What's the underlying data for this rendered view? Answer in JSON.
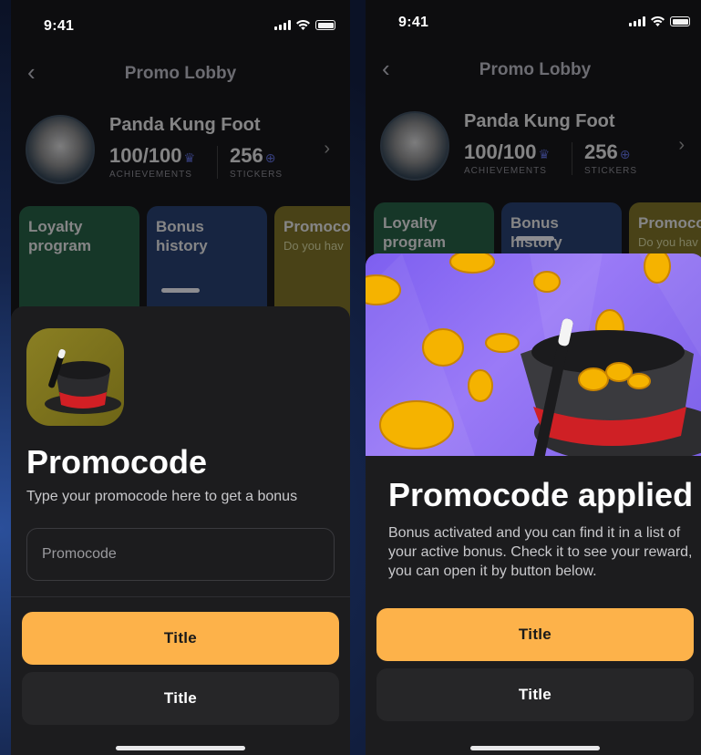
{
  "screens": [
    {
      "status": {
        "time": "9:41"
      },
      "nav": {
        "title": "Promo Lobby",
        "back": "‹"
      },
      "profile": {
        "name": "Panda Kung Foot",
        "achievements_value": "100/100",
        "achievements_label": "ACHIEVEMENTS",
        "stickers_value": "256",
        "stickers_label": "STICKERS"
      },
      "cards": [
        {
          "title": "Loyalty program"
        },
        {
          "title": "Bonus history"
        },
        {
          "title": "Promocode",
          "subtitle": "Do you hav"
        }
      ],
      "sheet": {
        "title": "Promocode",
        "description": "Type your promocode here to get a bonus",
        "input_value": "",
        "input_placeholder": "Promocode",
        "primary_button": "Title",
        "secondary_button": "Title"
      }
    },
    {
      "status": {
        "time": "9:41"
      },
      "nav": {
        "title": "Promo Lobby",
        "back": "‹"
      },
      "profile": {
        "name": "Panda Kung Foot",
        "achievements_value": "100/100",
        "achievements_label": "ACHIEVEMENTS",
        "stickers_value": "256",
        "stickers_label": "STICKERS"
      },
      "cards": [
        {
          "title": "Loyalty program"
        },
        {
          "title": "Bonus history"
        },
        {
          "title": "Promocode",
          "subtitle": "Do you hav"
        }
      ],
      "sheet": {
        "title": "Promocode applied",
        "description": "Bonus activated and you can find it in a list of your active bonus. Check it to see your reward, you can open it by button below.",
        "primary_button": "Title",
        "secondary_button": "Title"
      }
    }
  ],
  "icons": {
    "back": "chevron-left-icon",
    "profile_chevron": "chevron-right-icon",
    "signal": "cellular-signal-icon",
    "wifi": "wifi-icon",
    "battery": "battery-icon",
    "crown": "crown-icon",
    "plus": "plus-icon",
    "magic_hat": "magic-hat-icon"
  },
  "colors": {
    "primary_button": "#fdb24a",
    "sheet_bg": "#1c1c1e",
    "secondary_button": "#262628",
    "hero_bg": "#8b6cf4",
    "icon_bg": "#7d7220"
  }
}
